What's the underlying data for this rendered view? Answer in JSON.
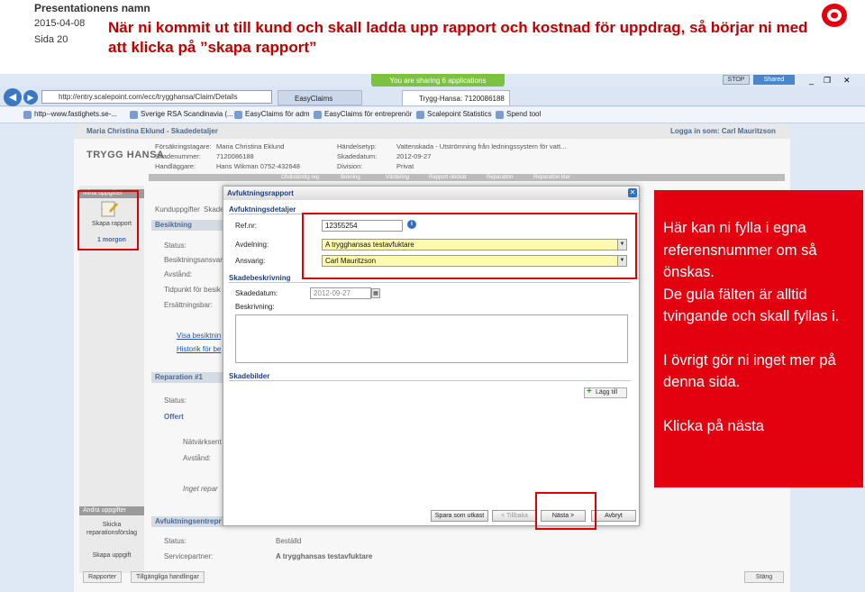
{
  "slide": {
    "presentation_name": "Presentationens namn",
    "date": "2015-04-08",
    "page": "Sida 20",
    "heading": "När ni kommit ut till kund och skall ladda upp rapport och kostnad för uppdrag, så börjar ni med att klicka på ”skapa rapport”"
  },
  "browser": {
    "share_banner": "You are sharing 6 applications",
    "stop_label": "STOP",
    "shared_label": "Shared",
    "url": "http://entry.scalepoint.com/ecc/trygghansa/Claim/Details",
    "tabs": [
      "EasyClaims",
      "Trygg-Hansa: 7120086188"
    ],
    "favorites": [
      "http--www.fastighets.se-...",
      "Sverige RSA Scandinavia (...",
      "EasyClaims för adm",
      "EasyClaims för entreprenör",
      "Scalepoint Statistics",
      "Spend tool"
    ]
  },
  "app": {
    "title": "Maria Christina Eklund - Skadedetaljer",
    "login": "Logga in som: Carl Mauritzson",
    "brand": "TRYGG HANSA",
    "header": {
      "forsakringstagare_label": "Försäkringstagare:",
      "forsakringstagare_value": "Maria Christina Eklund",
      "skadenummer_label": "Skadenummer:",
      "skadenummer_value": "7120086188",
      "handlaggare_label": "Handläggare:",
      "handlaggare_value": "Hans Wikman 0752-432648",
      "handelsetyp_label": "Händelsetyp:",
      "handelsetyp_value": "Vattenskada - Utströmning från ledningssystem för vatt...",
      "skadedatum_label": "Skadedatum:",
      "skadedatum_value": "2012-09-27",
      "division_label": "Division:",
      "division_value": "Privat"
    },
    "progress": [
      "Ofullständig reg",
      "Bokning",
      "Värdering",
      "Rapport skickat",
      "Reparation",
      "Reparation klar"
    ],
    "left_nav": {
      "section1": "Mina uppgifter",
      "skapa_rapport": "Skapa rapport",
      "time": "1 morgon",
      "section2": "Andra uppgifter",
      "skicka_forslag": "Skicka reparationsförslag",
      "skapa_uppgift": "Skapa uppgift"
    },
    "tabs_bg": [
      "Kunduppgifter",
      "Skade"
    ],
    "bg_sections": {
      "besiktning": "Besiktning",
      "status": "Status:",
      "besiktningsansvarig": "Besiktningsansvar",
      "avstand": "Avstånd:",
      "tidpunkt": "Tidpunkt för besik",
      "ersattning": "Ersättningsbar:",
      "visa_besiktning": "Visa besiktnin",
      "historik": "Historik för be",
      "reparation": "Reparation #1",
      "offert": "Offert",
      "natverk": "Nätvärksent",
      "avstand2": "Avstånd:",
      "inget_rep": "Inget repar",
      "avfuktning_entr": "Avfuktningsentrepr",
      "status2": "Status:",
      "status2_value": "Beställd",
      "servicepartner": "Servicepartner:",
      "servicepartner_value": "A trygghansas testavfuktare"
    },
    "bottom_buttons": [
      "Rapporter",
      "Tillgängliga handlingar",
      "Stäng"
    ]
  },
  "modal": {
    "title": "Avfuktningsrapport",
    "section_details": "Avfuktningsdetaljer",
    "refnr_label": "Ref.nr:",
    "refnr_value": "12355254",
    "avdelning_label": "Avdelning:",
    "avdelning_value": "A trygghansas testavfuktare",
    "ansvarig_label": "Ansvarig:",
    "ansvarig_value": "Carl Mauritzson",
    "section_skade": "Skadebeskrivning",
    "skadedatum_label": "Skadedatum:",
    "skadedatum_value": "2012-09-27",
    "beskrivning_label": "Beskrivning:",
    "section_bilder": "Skadebilder",
    "lagg_till": "Lägg till",
    "btn_spara": "Spara som utkast",
    "btn_tillbaka": "< Tillbaka",
    "btn_nasta": "Nästa >",
    "btn_avbryt": "Avbryt"
  },
  "callout": {
    "p1": "Här kan ni fylla i egna referensnummer om så önskas.",
    "p2": "De gula fälten är alltid tvingande och skall fyllas i.",
    "p3": "I övrigt gör ni inget mer på denna sida.",
    "p4": "Klicka på nästa"
  },
  "colors": {
    "accent_red": "#e3000f",
    "heading_red": "#c00000",
    "required_yellow": "#fffab0",
    "link_blue": "#1e3f7a"
  }
}
